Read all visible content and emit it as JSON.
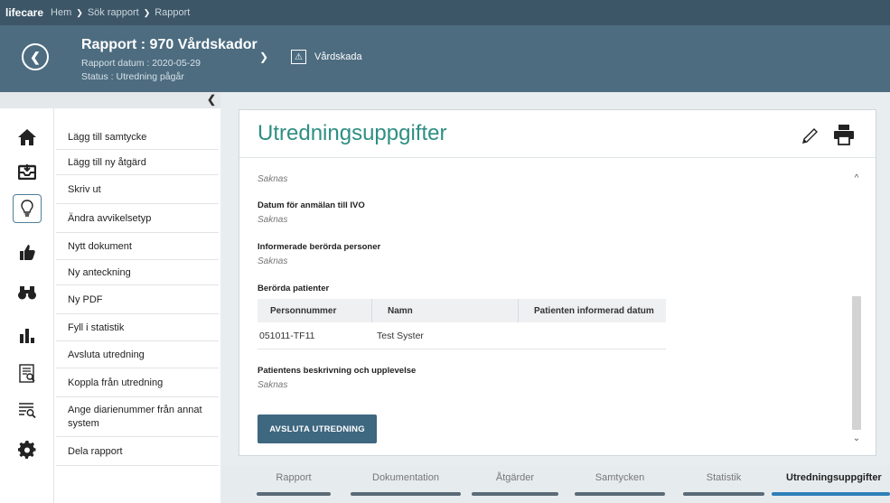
{
  "topbar": {
    "brand": "lifecare",
    "breadcrumb": [
      "Hem",
      "Sök rapport",
      "Rapport"
    ]
  },
  "header": {
    "title": "Rapport : 970 Vårdskador",
    "date_line": "Rapport datum : 2020-05-29",
    "status_line": "Status : Utredning pågår",
    "badge_label": "Vårdskada"
  },
  "rail_icons": [
    "home-icon",
    "inbox-icon",
    "lightbulb-icon",
    "thumbs-up-icon",
    "binoculars-icon",
    "bar-chart-icon",
    "report-search-icon",
    "list-search-icon",
    "gear-icon"
  ],
  "menu": {
    "items": [
      "Lägg till samtycke",
      "Lägg till ny åtgärd",
      "Skriv ut",
      "Ändra avvikelsetyp",
      "Nytt dokument",
      "Ny anteckning",
      "Ny PDF",
      "Fyll i statistik",
      "Avsluta utredning",
      "Koppla från utredning",
      "Ange diarienummer från annat system",
      "Dela rapport"
    ]
  },
  "panel": {
    "title": "Utredningsuppgifter",
    "top_value": "Saknas",
    "fields": [
      {
        "label": "Datum för anmälan till IVO",
        "value": "Saknas"
      },
      {
        "label": "Informerade berörda personer",
        "value": "Saknas"
      },
      {
        "label": "Berörda patienter",
        "value": ""
      },
      {
        "label": "Patientens beskrivning och upplevelse",
        "value": "Saknas"
      }
    ],
    "table": {
      "columns": [
        "Personnummer",
        "Namn",
        "Patienten informerad datum"
      ],
      "rows": [
        [
          "051011-TF11",
          "Test Syster",
          ""
        ]
      ]
    },
    "action_button": "AVSLUTA UTREDNING"
  },
  "tabs": [
    {
      "label": "Rapport",
      "active": false
    },
    {
      "label": "Dokumentation",
      "active": false
    },
    {
      "label": "Åtgärder",
      "active": false
    },
    {
      "label": "Samtycken",
      "active": false
    },
    {
      "label": "Statistik",
      "active": false
    },
    {
      "label": "Utredningsuppgifter",
      "active": true
    }
  ],
  "colors": {
    "topbar": "#3d5667",
    "header": "#4d6c80",
    "title_accent": "#2e8f84",
    "button": "#3e6780",
    "active_tab": "#2e7fb8"
  }
}
